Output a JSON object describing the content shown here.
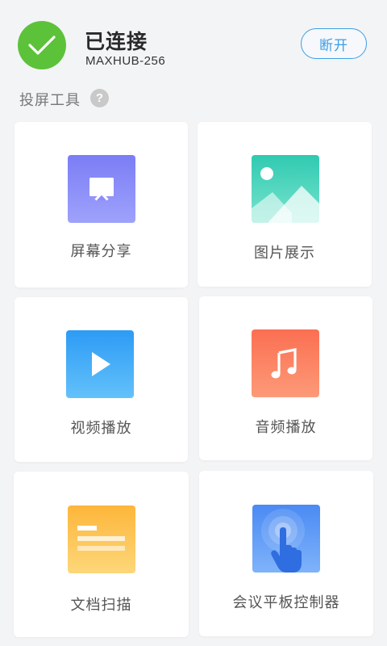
{
  "header": {
    "status_title": "已连接",
    "device_name": "MAXHUB-256",
    "disconnect_label": "断开"
  },
  "section": {
    "title": "投屏工具",
    "help_symbol": "?"
  },
  "tools": [
    {
      "label": "屏幕分享",
      "icon": "screen-share-icon"
    },
    {
      "label": "图片展示",
      "icon": "image-icon"
    },
    {
      "label": "视频播放",
      "icon": "video-play-icon"
    },
    {
      "label": "音频播放",
      "icon": "music-note-icon"
    },
    {
      "label": "文档扫描",
      "icon": "document-icon"
    },
    {
      "label": "会议平板控制器",
      "icon": "touch-hand-icon"
    }
  ],
  "colors": {
    "connected_green": "#5cc23a",
    "accent_blue": "#3e9ee6",
    "background": "#f3f4f6"
  }
}
